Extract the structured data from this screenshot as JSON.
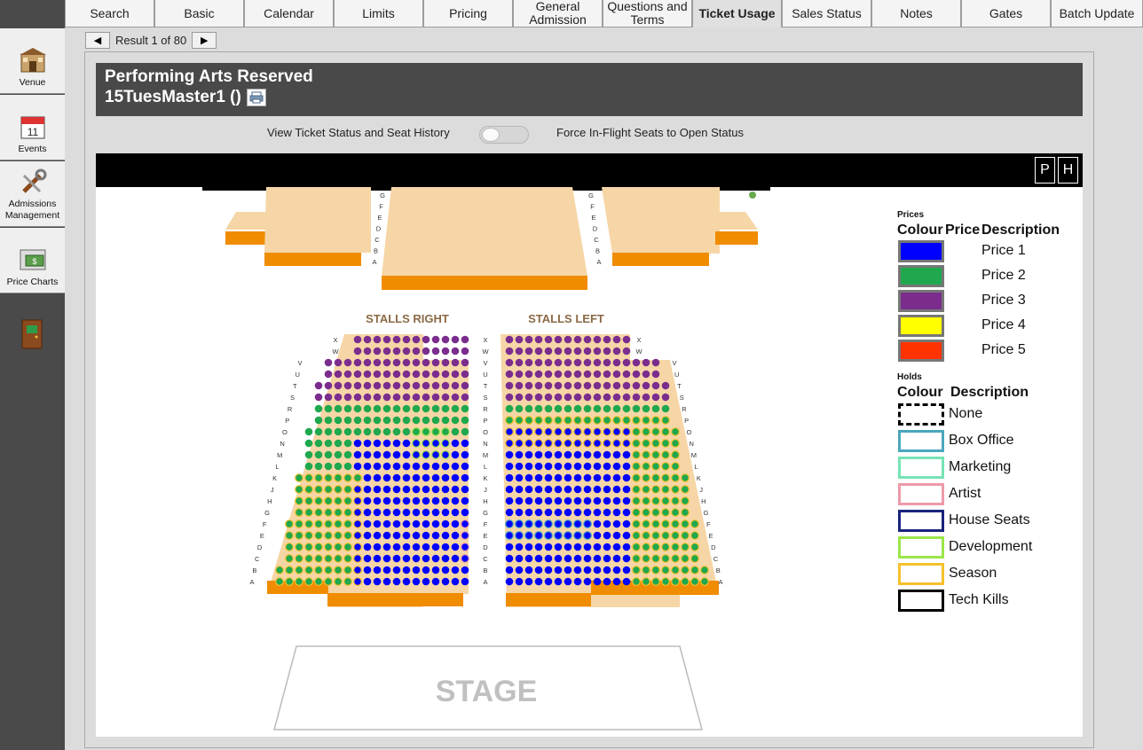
{
  "tabs": [
    {
      "label": "Search"
    },
    {
      "label": "Basic"
    },
    {
      "label": "Calendar"
    },
    {
      "label": "Limits"
    },
    {
      "label": "Pricing"
    },
    {
      "label": "General Admission"
    },
    {
      "label": "Questions and Terms"
    },
    {
      "label": "Ticket Usage",
      "active": true
    },
    {
      "label": "Sales Status"
    },
    {
      "label": "Notes"
    },
    {
      "label": "Gates"
    },
    {
      "label": "Batch Update"
    }
  ],
  "sidebar": {
    "items": [
      {
        "label": "Venue",
        "icon": "venue-icon"
      },
      {
        "label": "Events",
        "icon": "calendar-icon"
      },
      {
        "label": "Admissions Management",
        "icon": "tools-icon"
      },
      {
        "label": "Price Charts",
        "icon": "price-chart-icon"
      }
    ],
    "exit_icon": "exit-door-icon"
  },
  "pager": {
    "prev": "◀",
    "next": "▶",
    "text": "Result 1 of 80"
  },
  "header": {
    "title": "Performing Arts Reserved",
    "subtitle": "15TuesMaster1 ()",
    "print_icon": "printer-icon"
  },
  "toggles": {
    "ticket_status": "View Ticket Status and Seat History",
    "force_inflight": "Force In-Flight Seats to Open Status"
  },
  "map": {
    "btn_p": "P",
    "btn_h": "H",
    "stalls_right": "STALLS RIGHT",
    "stalls_left": "STALLS LEFT",
    "stage": "STAGE",
    "rows_main": [
      "X",
      "W",
      "V",
      "U",
      "T",
      "S",
      "R",
      "P",
      "O",
      "N",
      "M",
      "L",
      "K",
      "J",
      "H",
      "G",
      "F",
      "E",
      "D",
      "C",
      "B",
      "A"
    ],
    "rows_upper": [
      "G",
      "F",
      "E",
      "D",
      "C",
      "B",
      "A"
    ]
  },
  "legend": {
    "prices_title": "Prices",
    "col_colour": "Colour",
    "col_price": "Price",
    "col_desc": "Description",
    "prices": [
      {
        "label": "Price 1",
        "color": "#0000ff"
      },
      {
        "label": "Price 2",
        "color": "#1fa84e"
      },
      {
        "label": "Price 3",
        "color": "#7b2d8e"
      },
      {
        "label": "Price 4",
        "color": "#ffff00"
      },
      {
        "label": "Price 5",
        "color": "#ff3300"
      }
    ],
    "holds_title": "Holds",
    "holds_col_colour": "Colour",
    "holds_col_desc": "Description",
    "holds": [
      {
        "label": "None",
        "color": "#000000",
        "style": "dashed"
      },
      {
        "label": "Box Office",
        "color": "#4aa7bd"
      },
      {
        "label": "Marketing",
        "color": "#77e3b5"
      },
      {
        "label": "Artist",
        "color": "#ee9aa8"
      },
      {
        "label": "House Seats",
        "color": "#1a237e"
      },
      {
        "label": "Development",
        "color": "#9be64a"
      },
      {
        "label": "Season",
        "color": "#f5c12c"
      },
      {
        "label": "Tech Kills",
        "color": "#000000"
      }
    ]
  }
}
